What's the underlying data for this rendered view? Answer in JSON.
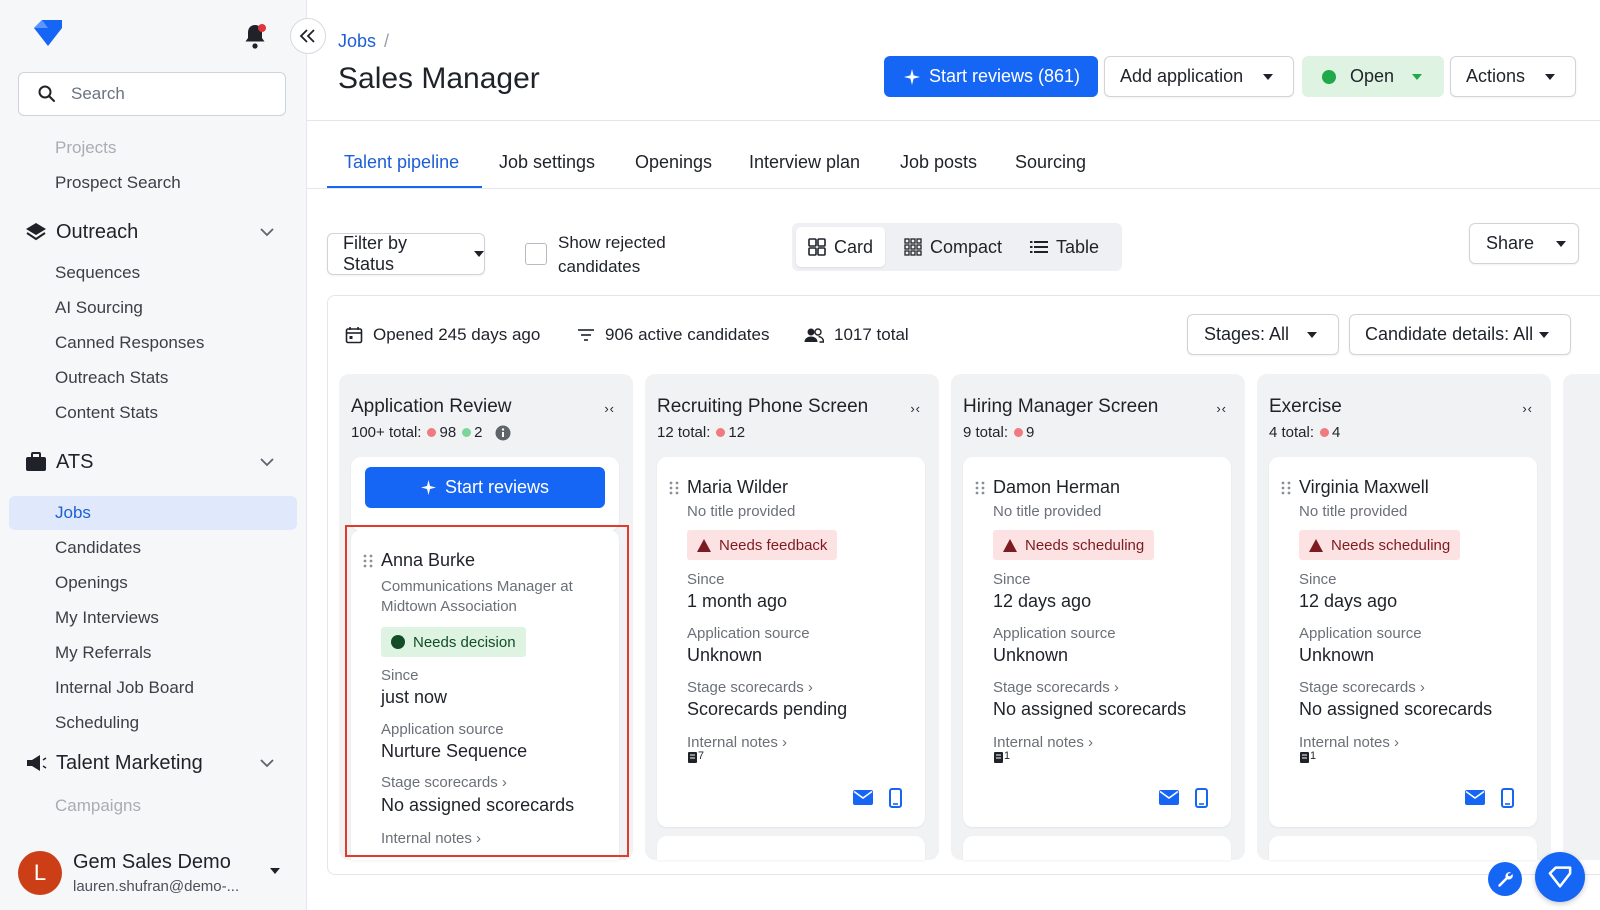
{
  "sidebar": {
    "search_placeholder": "Search",
    "items_top": [
      "Projects",
      "Prospect Search"
    ],
    "outreach": {
      "title": "Outreach",
      "items": [
        "Sequences",
        "AI Sourcing",
        "Canned Responses",
        "Outreach Stats",
        "Content Stats"
      ]
    },
    "ats": {
      "title": "ATS",
      "items": [
        "Jobs",
        "Candidates",
        "Openings",
        "My Interviews",
        "My Referrals",
        "Internal Job Board",
        "Scheduling"
      ]
    },
    "talent_marketing": {
      "title": "Talent Marketing",
      "items": [
        "Campaigns"
      ]
    },
    "user": {
      "initial": "L",
      "name": "Gem Sales Demo",
      "email": "lauren.shufran@demo-..."
    }
  },
  "header": {
    "breadcrumb": "Jobs",
    "breadcrumb_sep": "/",
    "title": "Sales Manager",
    "start_reviews": "Start reviews (861)",
    "add_application": "Add application",
    "status": "Open",
    "actions": "Actions"
  },
  "tabs": [
    "Talent pipeline",
    "Job settings",
    "Openings",
    "Interview plan",
    "Job posts",
    "Sourcing"
  ],
  "toolbar": {
    "filter": "Filter by Status",
    "show_rejected": "Show rejected candidates",
    "views": [
      "Card",
      "Compact",
      "Table"
    ],
    "share": "Share"
  },
  "stats": {
    "opened": "Opened 245 days ago",
    "active": "906 active candidates",
    "total": "1017 total",
    "stages_filter": "Stages: All",
    "details_filter": "Candidate details: All"
  },
  "columns": [
    {
      "title": "Application Review",
      "total_label": "100+ total:",
      "red": "98",
      "green": "2",
      "start_reviews": "Start reviews",
      "card": {
        "name": "Anna Burke",
        "title_line1": "Communications Manager at",
        "title_line2": "Midtown Association",
        "badge": "Needs decision",
        "since_label": "Since",
        "since": "just now",
        "source_label": "Application source",
        "source": "Nurture Sequence",
        "scorecards_label": "Stage scorecards ›",
        "scorecards": "No assigned scorecards",
        "notes_label": "Internal notes ›"
      }
    },
    {
      "title": "Recruiting Phone Screen",
      "total_label": "12 total:",
      "red": "12",
      "card": {
        "name": "Maria Wilder",
        "title": "No title provided",
        "badge": "Needs feedback",
        "since_label": "Since",
        "since": "1 month ago",
        "source_label": "Application source",
        "source": "Unknown",
        "scorecards_label": "Stage scorecards ›",
        "scorecards": "Scorecards pending",
        "notes_label": "Internal notes ›",
        "notes_count": "7"
      }
    },
    {
      "title": "Hiring Manager Screen",
      "total_label": "9 total:",
      "red": "9",
      "card": {
        "name": "Damon Herman",
        "title": "No title provided",
        "badge": "Needs scheduling",
        "since_label": "Since",
        "since": "12 days ago",
        "source_label": "Application source",
        "source": "Unknown",
        "scorecards_label": "Stage scorecards ›",
        "scorecards": "No assigned scorecards",
        "notes_label": "Internal notes ›",
        "notes_count": "1"
      }
    },
    {
      "title": "Exercise",
      "total_label": "4 total:",
      "red": "4",
      "card": {
        "name": "Virginia Maxwell",
        "title": "No title provided",
        "badge": "Needs scheduling",
        "since_label": "Since",
        "since": "12 days ago",
        "source_label": "Application source",
        "source": "Unknown",
        "scorecards_label": "Stage scorecards ›",
        "scorecards": "No assigned scorecards",
        "notes_label": "Internal notes ›",
        "notes_count": "1"
      }
    }
  ],
  "colors": {
    "primary": "#1666f5",
    "link": "#1d5fd6",
    "open_bg": "#dff3e2",
    "open_dot": "#1fa94a",
    "warn_bg": "#fde2e3",
    "highlight": "#e23b2e"
  }
}
